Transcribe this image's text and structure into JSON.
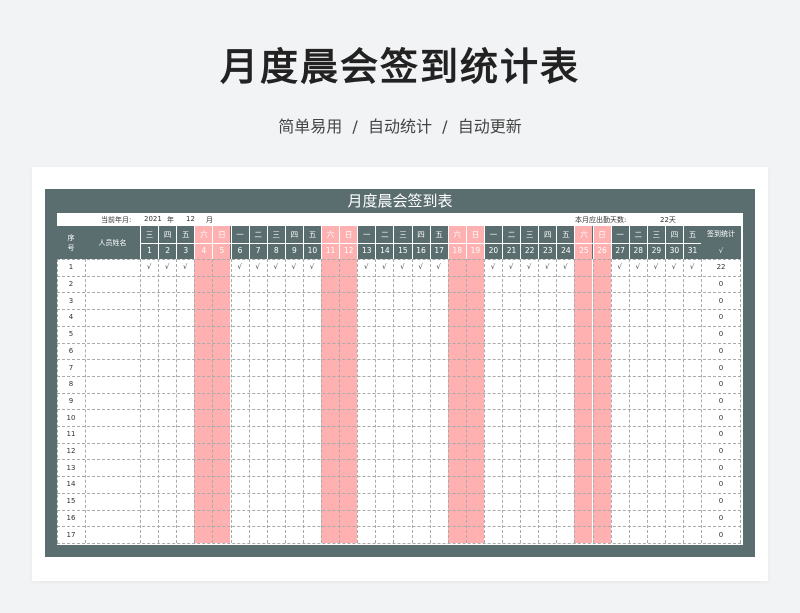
{
  "page": {
    "title": "月度晨会签到统计表",
    "subtitle": "简单易用  /  自动统计  /  自动更新"
  },
  "sheet": {
    "title": "月度晨会签到表",
    "info": {
      "current_label": "当前年月:",
      "year": "2021",
      "year_unit": "年",
      "month": "12",
      "month_unit": "月",
      "due_label": "本月应出勤天数:",
      "due_value": "22天"
    },
    "headers": {
      "seq": "序号",
      "name": "人员姓名",
      "stat": "签到统计",
      "stat_mark": "√"
    },
    "days": [
      {
        "w": "三",
        "d": "1"
      },
      {
        "w": "四",
        "d": "2"
      },
      {
        "w": "五",
        "d": "3"
      },
      {
        "w": "六",
        "d": "4",
        "weekend": true
      },
      {
        "w": "日",
        "d": "5",
        "weekend": true
      },
      {
        "w": "一",
        "d": "6"
      },
      {
        "w": "二",
        "d": "7"
      },
      {
        "w": "三",
        "d": "8"
      },
      {
        "w": "四",
        "d": "9"
      },
      {
        "w": "五",
        "d": "10"
      },
      {
        "w": "六",
        "d": "11",
        "weekend": true
      },
      {
        "w": "日",
        "d": "12",
        "weekend": true
      },
      {
        "w": "一",
        "d": "13"
      },
      {
        "w": "二",
        "d": "14"
      },
      {
        "w": "三",
        "d": "15"
      },
      {
        "w": "四",
        "d": "16"
      },
      {
        "w": "五",
        "d": "17"
      },
      {
        "w": "六",
        "d": "18",
        "weekend": true
      },
      {
        "w": "日",
        "d": "19",
        "weekend": true
      },
      {
        "w": "一",
        "d": "20"
      },
      {
        "w": "二",
        "d": "21"
      },
      {
        "w": "三",
        "d": "22"
      },
      {
        "w": "四",
        "d": "23"
      },
      {
        "w": "五",
        "d": "24"
      },
      {
        "w": "六",
        "d": "25",
        "weekend": true
      },
      {
        "w": "日",
        "d": "26",
        "weekend": true
      },
      {
        "w": "一",
        "d": "27"
      },
      {
        "w": "二",
        "d": "28"
      },
      {
        "w": "三",
        "d": "29"
      },
      {
        "w": "四",
        "d": "30"
      },
      {
        "w": "五",
        "d": "31"
      }
    ],
    "check_mark": "√",
    "rows": [
      {
        "seq": "1",
        "total": "22",
        "checks": [
          1,
          1,
          1,
          0,
          0,
          1,
          1,
          1,
          1,
          1,
          0,
          0,
          1,
          1,
          1,
          1,
          1,
          0,
          0,
          1,
          1,
          1,
          1,
          1,
          0,
          0,
          1,
          1,
          1,
          1,
          1
        ]
      },
      {
        "seq": "2",
        "total": "0"
      },
      {
        "seq": "3",
        "total": "0"
      },
      {
        "seq": "4",
        "total": "0"
      },
      {
        "seq": "5",
        "total": "0"
      },
      {
        "seq": "6",
        "total": "0"
      },
      {
        "seq": "7",
        "total": "0"
      },
      {
        "seq": "8",
        "total": "0"
      },
      {
        "seq": "9",
        "total": "0"
      },
      {
        "seq": "10",
        "total": "0"
      },
      {
        "seq": "11",
        "total": "0"
      },
      {
        "seq": "12",
        "total": "0"
      },
      {
        "seq": "13",
        "total": "0"
      },
      {
        "seq": "14",
        "total": "0"
      },
      {
        "seq": "15",
        "total": "0"
      },
      {
        "seq": "16",
        "total": "0"
      },
      {
        "seq": "17",
        "total": "0"
      }
    ]
  }
}
